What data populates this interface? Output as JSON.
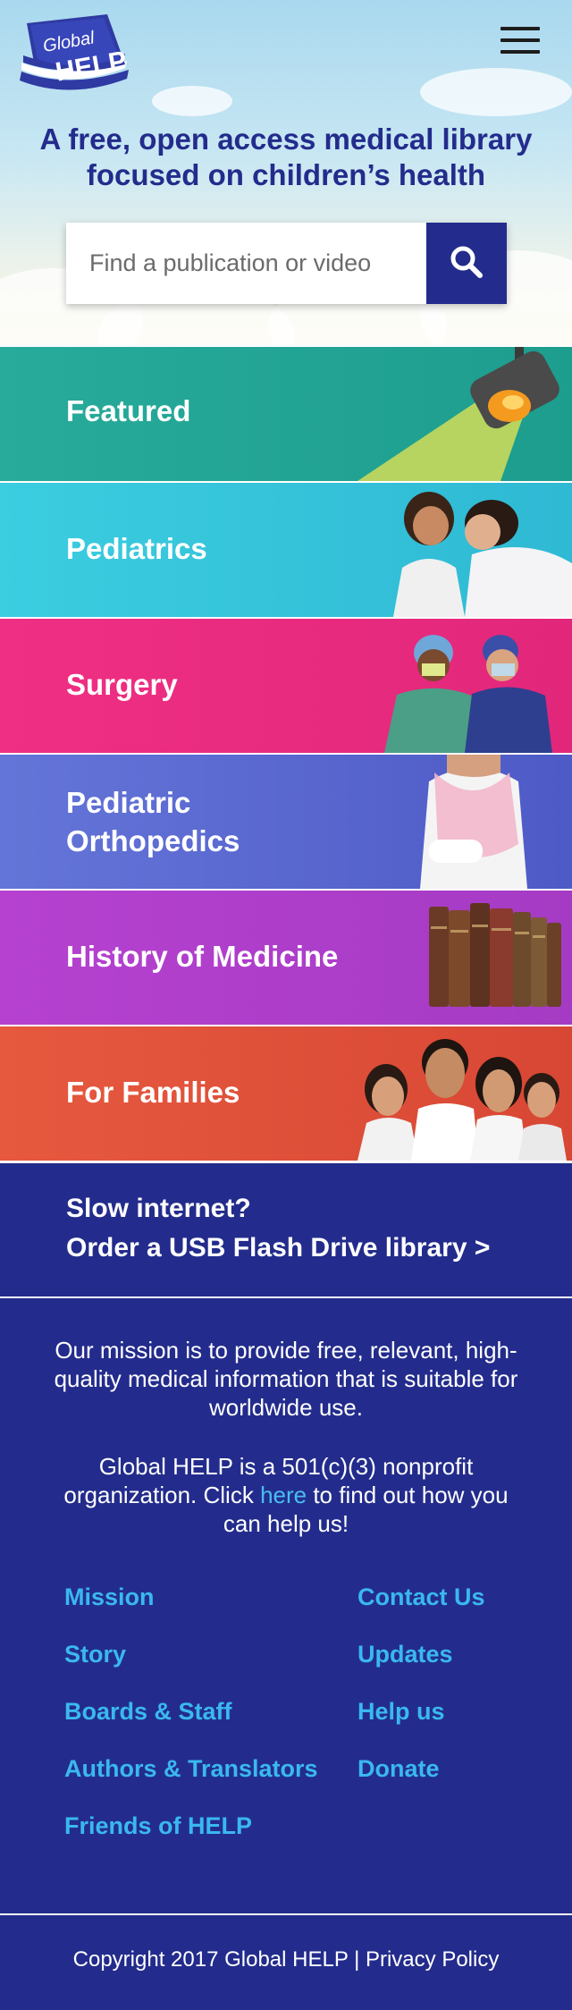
{
  "header": {
    "logo": {
      "line1": "Global",
      "line2": "HELP"
    },
    "tagline": "A free, open access medical library focused on children’s health",
    "search": {
      "placeholder": "Find a publication or video"
    }
  },
  "categories": [
    {
      "label": "Featured",
      "color": "#27a89a"
    },
    {
      "label": "Pediatrics",
      "color": "#38c8dc"
    },
    {
      "label": "Surgery",
      "color": "#ec2d81"
    },
    {
      "label": "Pediatric Orthopedics",
      "line1": "Pediatric",
      "line2": "Orthopedics",
      "color": "#5b68d2"
    },
    {
      "label": "History of Medicine",
      "color": "#b13fcd"
    },
    {
      "label": "For Families",
      "color": "#e4533c"
    }
  ],
  "usb": {
    "line1": "Slow internet?",
    "line2": "Order a USB Flash Drive library >"
  },
  "footer": {
    "mission_1": "Our mission is to provide free, relevant, high-quality medical information that is suitable for worldwide use.",
    "mission_2_pre": "Global HELP is a 501(c)(3) nonprofit organization. Click ",
    "mission_2_link": "here",
    "mission_2_post": " to find out how you can help us!",
    "links_left": [
      "Mission",
      "Story",
      "Boards & Staff",
      "Authors & Translators",
      "Friends of HELP"
    ],
    "links_right": [
      "Contact Us",
      "Updates",
      "Help us",
      "Donate"
    ],
    "copyright": "Copyright 2017 Global HELP | Privacy Policy"
  },
  "colors": {
    "brand_navy": "#232c8c",
    "link_blue": "#3ab8ef"
  },
  "icons": [
    "globalhelp-logo",
    "menu-icon",
    "search-icon",
    "spotlight-icon"
  ]
}
